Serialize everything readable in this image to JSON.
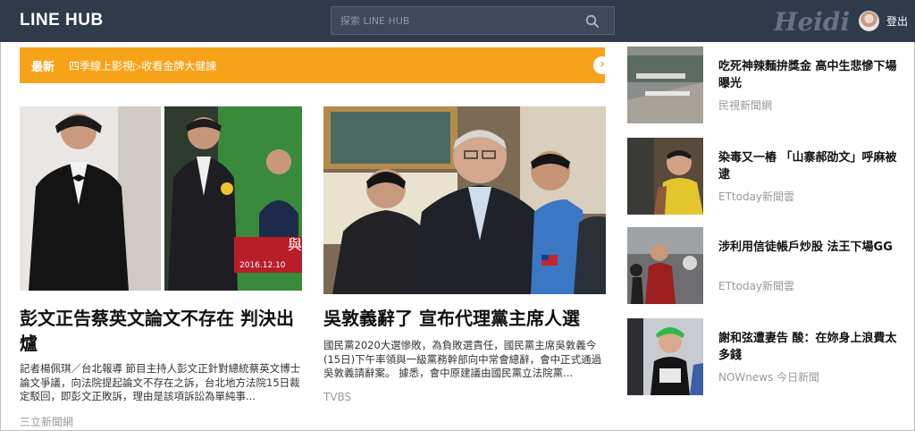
{
  "header": {
    "logo": "LINE HUB",
    "search_placeholder": "探索 LINE HUB",
    "signature": "Heidi",
    "logout": "登出"
  },
  "banner": {
    "tag": "最新",
    "text": "四季線上影視▷收看金牌大健諫"
  },
  "articles": [
    {
      "title": "彭文正告蔡英文論文不存在 判決出爐",
      "desc": "記者楊佩琪／台北報導 節目主持人彭文正針對總統蔡英文博士論文爭議，向法院提起論文不存在之訴，台北地方法院15日裁定駁回，即彭文正敗訴，理由是該項訴訟為單純事...",
      "source": "三立新聞網",
      "photo_caption": "2016.12.10"
    },
    {
      "title": "吳敦義辭了 宣布代理黨主席人選",
      "desc": "國民黨2020大選慘敗，為負敗選責任，國民黨主席吳敦義今(15日)下午率領與一級黨務幹部向中常會總辭，會中正式通過吳敦義請辭案。 據悉，會中原建議由國民黨立法院黨...",
      "source": "TVBS"
    }
  ],
  "side_news": [
    {
      "title": "吃死神辣麵拚獎金 高中生悲慘下場曝光",
      "source": "民視新聞網"
    },
    {
      "title": "染毒又一樁 「山寨郝劭文」呼麻被逮",
      "source": "ETtoday新聞雲"
    },
    {
      "title": "涉利用信徒帳戶炒股 法王下場GG",
      "source": "ETtoday新聞雲"
    },
    {
      "title": "謝和弦遭妻告 酸：在妳身上浪費太多錢",
      "source": "NOWnews 今日新聞"
    }
  ],
  "colors": {
    "header_bg": "#2f3a4b",
    "banner_bg": "#f7a31a"
  }
}
